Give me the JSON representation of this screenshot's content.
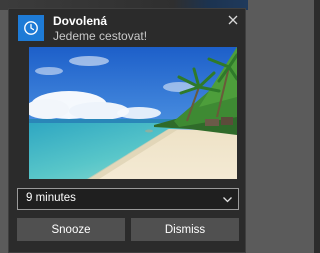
{
  "notification": {
    "app_icon": "alarm-clock-icon",
    "title": "Dovolená",
    "subtitle": "Jedeme cestovat!",
    "close_icon": "close-icon",
    "image": "tropical-beach-photo"
  },
  "snooze": {
    "selected": "9 minutes",
    "chevron_icon": "chevron-down-icon"
  },
  "actions": {
    "snooze_label": "Snooze",
    "dismiss_label": "Dismiss"
  },
  "colors": {
    "app_icon_bg": "#1e7bd6",
    "toast_bg": "#2b2b2b",
    "button_bg": "#505050",
    "select_border": "#9a9a9a"
  }
}
